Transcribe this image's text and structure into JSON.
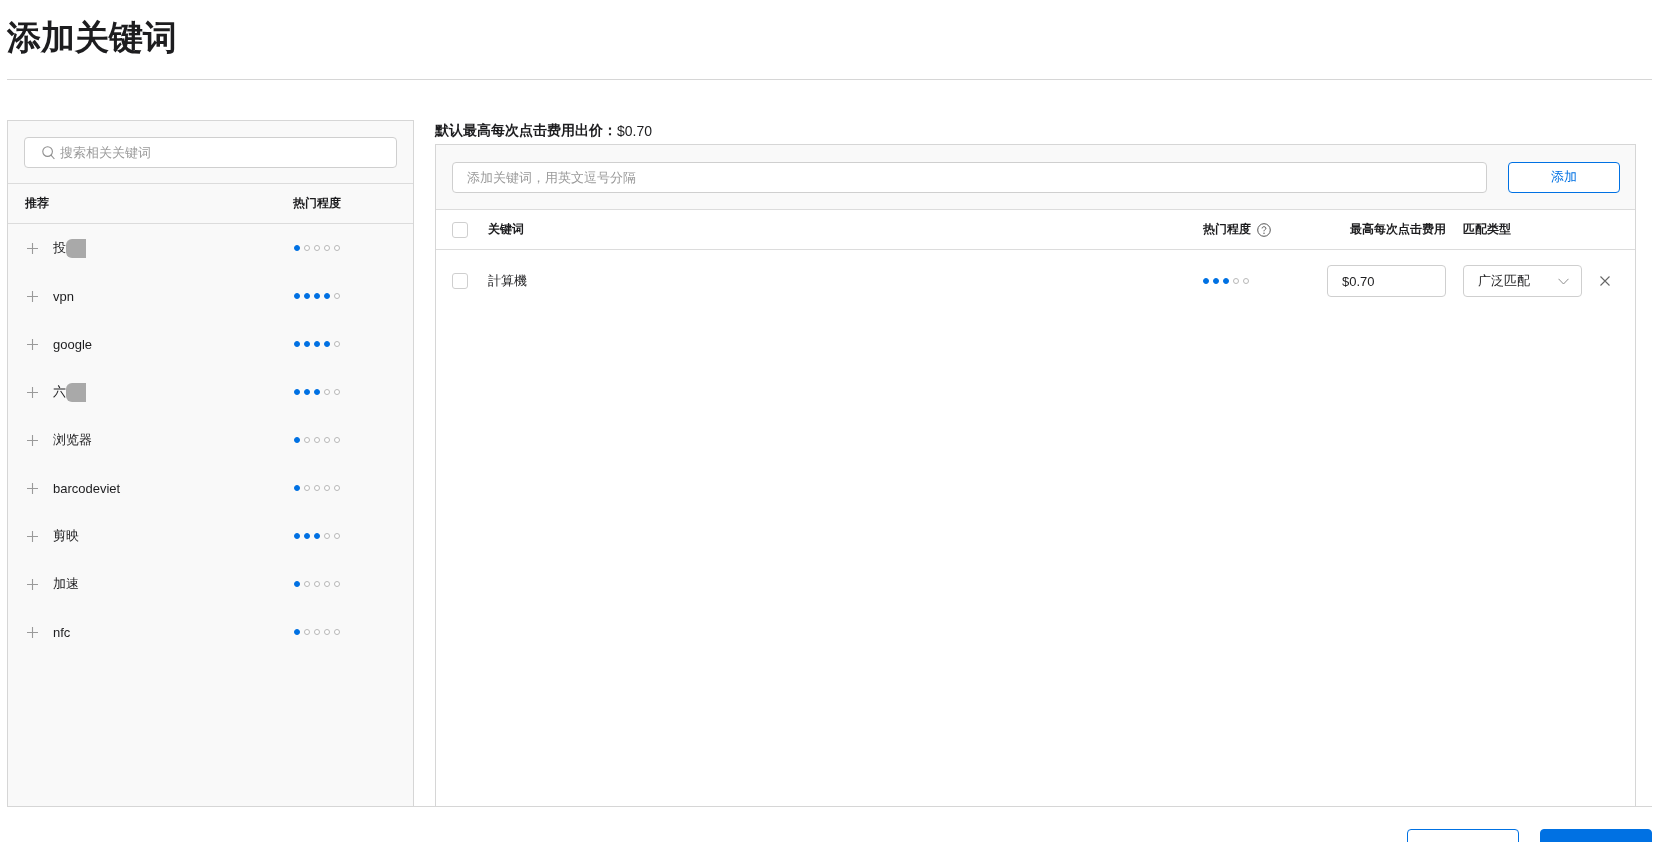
{
  "page": {
    "title": "添加关键词"
  },
  "suggestions": {
    "search": {
      "placeholder": "搜索相关关键词"
    },
    "columns": [
      "推荐",
      "热门程度"
    ],
    "items": [
      {
        "keyword": "投",
        "redacted": true,
        "stars": 1
      },
      {
        "keyword": "vpn",
        "redacted": false,
        "stars": 4
      },
      {
        "keyword": "google",
        "redacted": false,
        "stars": 4
      },
      {
        "keyword": "六",
        "redacted": true,
        "stars": 3
      },
      {
        "keyword": "浏览器",
        "redacted": false,
        "stars": 1
      },
      {
        "keyword": "barcodeviet",
        "redacted": false,
        "stars": 1
      },
      {
        "keyword": "剪映",
        "redacted": false,
        "stars": 3
      },
      {
        "keyword": "加速",
        "redacted": false,
        "stars": 1
      },
      {
        "keyword": "nfc",
        "redacted": false,
        "stars": 1
      }
    ]
  },
  "keywords": {
    "default_bid": {
      "label": "默认最高每次点击费用出价：",
      "value": "$0.70"
    },
    "input": {
      "placeholder": "添加关键词，用英文逗号分隔"
    },
    "add_button": "添加",
    "select_all": {
      "checked": false
    },
    "columns": [
      {
        "label": "关键词",
        "help": false
      },
      {
        "label": "热门程度",
        "help": true
      },
      {
        "label": "最高每次点击费用",
        "help": false
      },
      {
        "label": "匹配类型",
        "help": false
      }
    ],
    "rows": [
      {
        "checked": false,
        "keyword": "計算機",
        "stars": 3,
        "bid": "$0.70",
        "match_type": "广泛匹配"
      }
    ]
  },
  "footer": {
    "buttons": [
      {
        "kind": "secondary"
      },
      {
        "kind": "primary"
      }
    ]
  }
}
